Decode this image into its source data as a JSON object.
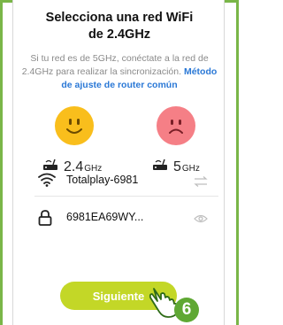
{
  "header": {
    "title_line1": "Selecciona una red WiFi",
    "title_line2": "de 2.4GHz"
  },
  "description": {
    "text": "Si tu red es de 5GHz, conéctate a la red de 2.4GHz para realizar la sincronización. ",
    "link": "Método de ajuste de router común"
  },
  "bands": {
    "b24": {
      "value": "2.4",
      "unit": "GHz"
    },
    "b5": {
      "value": "5",
      "unit": "GHz"
    }
  },
  "wifi": {
    "ssid": "Totalplay-6981",
    "icon": "wifi-icon",
    "action_icon": "swap-arrows-icon"
  },
  "password": {
    "value": "6981EA69WY...",
    "icon": "lock-icon",
    "action_icon": "eye-icon"
  },
  "button": {
    "label": "Siguiente"
  },
  "step_badge": "6",
  "colors": {
    "frame": "#7ab648",
    "button": "#c3d727",
    "link": "#2a78d6",
    "happy_face": "#f9be1c",
    "sad_face": "#f57f86",
    "badge": "#5fa833"
  }
}
